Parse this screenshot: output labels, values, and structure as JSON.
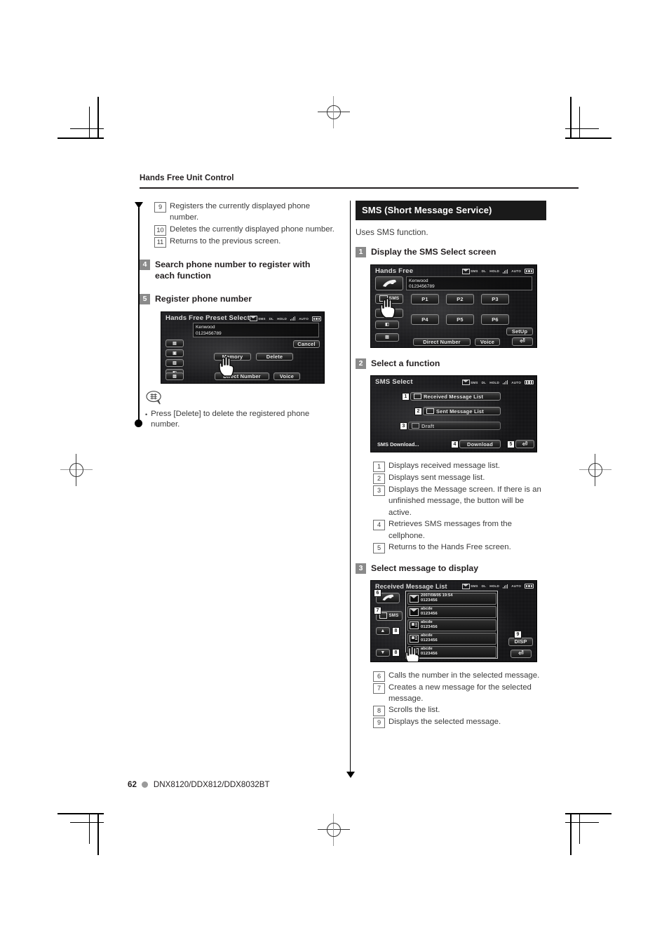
{
  "page": {
    "running_head": "Hands Free Unit Control",
    "page_number": "62",
    "models": "DNX8120/DDX812/DDX8032BT"
  },
  "left_column": {
    "references": [
      {
        "num": "9",
        "text": "Registers the currently displayed phone number."
      },
      {
        "num": "10",
        "text": "Deletes the currently displayed phone number."
      },
      {
        "num": "11",
        "text": "Returns to the previous screen."
      }
    ],
    "steps": [
      {
        "num": "4",
        "title": "Search phone number to register with each function"
      },
      {
        "num": "5",
        "title": "Register phone number"
      }
    ],
    "memo": {
      "icon": "memo-balloon-icon",
      "bullet": "•",
      "text": "Press [Delete] to delete the registered phone number."
    },
    "preset_screen": {
      "title": "Hands Free Preset Select",
      "caller_name": "Kenwood",
      "caller_number": "0123456789",
      "cancel_label": "Cancel",
      "memory_label": "Memory",
      "delete_label": "Delete",
      "direct_number_label": "Direct Number",
      "voice_label": "Voice",
      "status": {
        "sms": "SMS",
        "dl": "DL",
        "hold": "HOLD",
        "auto": "AUTO"
      }
    }
  },
  "right_column": {
    "section": {
      "banner": "SMS (Short Message Service)",
      "intro": "Uses SMS function."
    },
    "steps": [
      {
        "num": "1",
        "title": "Display the SMS Select screen"
      },
      {
        "num": "2",
        "title": "Select a function"
      },
      {
        "num": "3",
        "title": "Select message to display"
      }
    ],
    "hands_free_screen": {
      "title": "Hands Free",
      "caller_name": "Kenwood",
      "caller_number": "0123456789",
      "sms_label": "SMS",
      "presets": [
        "P1",
        "P2",
        "P3",
        "P4",
        "P5",
        "P6"
      ],
      "setup_label": "SetUp",
      "direct_number_label": "Direct Number",
      "voice_label": "Voice",
      "status": {
        "sms": "SMS",
        "dl": "DL",
        "hold": "HOLD",
        "auto": "AUTO"
      }
    },
    "sms_select_screen": {
      "title": "SMS Select",
      "items": [
        {
          "callout": "1",
          "label": "Received Message List"
        },
        {
          "callout": "2",
          "label": "Sent Message List"
        },
        {
          "callout": "3",
          "label": "Draft"
        }
      ],
      "download_status": "SMS Download...",
      "download_callout": "4",
      "download_label": "Download",
      "return_callout": "5",
      "status": {
        "sms": "SMS",
        "dl": "DL",
        "hold": "HOLD",
        "auto": "AUTO"
      }
    },
    "sms_select_refs": [
      {
        "num": "1",
        "text": "Displays received message list."
      },
      {
        "num": "2",
        "text": "Displays sent message list."
      },
      {
        "num": "3",
        "text": "Displays the Message screen. If there is an unfinished message, the button will be active."
      },
      {
        "num": "4",
        "text": "Retrieves SMS messages from the cellphone."
      },
      {
        "num": "5",
        "text": "Returns to the Hands Free screen."
      }
    ],
    "received_list_screen": {
      "title": "Received Message List",
      "sms_label": "SMS",
      "disp_label": "DISP",
      "call_callout": "6",
      "new_msg_callout": "7",
      "scroll_up_callout": "8",
      "scroll_down_callout": "8",
      "disp_callout": "9",
      "messages": [
        {
          "icon": "envelope-icon",
          "line1": "2007/08/05   19:54",
          "line2": "0123456"
        },
        {
          "icon": "envelope-icon",
          "line1": "abcde",
          "line2": "0123456"
        },
        {
          "icon": "document-icon",
          "line1": "abcde",
          "line2": "0123456"
        },
        {
          "icon": "document-icon",
          "line1": "abcde",
          "line2": "0123456"
        },
        {
          "icon": "document-icon",
          "line1": "abcde",
          "line2": "0123456"
        }
      ],
      "status": {
        "sms": "SMS",
        "dl": "DL",
        "hold": "HOLD",
        "auto": "AUTO"
      }
    },
    "received_list_refs": [
      {
        "num": "6",
        "text": "Calls the number in the selected message."
      },
      {
        "num": "7",
        "text": "Creates a new message for the selected message."
      },
      {
        "num": "8",
        "text": "Scrolls the list."
      },
      {
        "num": "9",
        "text": "Displays the selected message."
      }
    ]
  }
}
